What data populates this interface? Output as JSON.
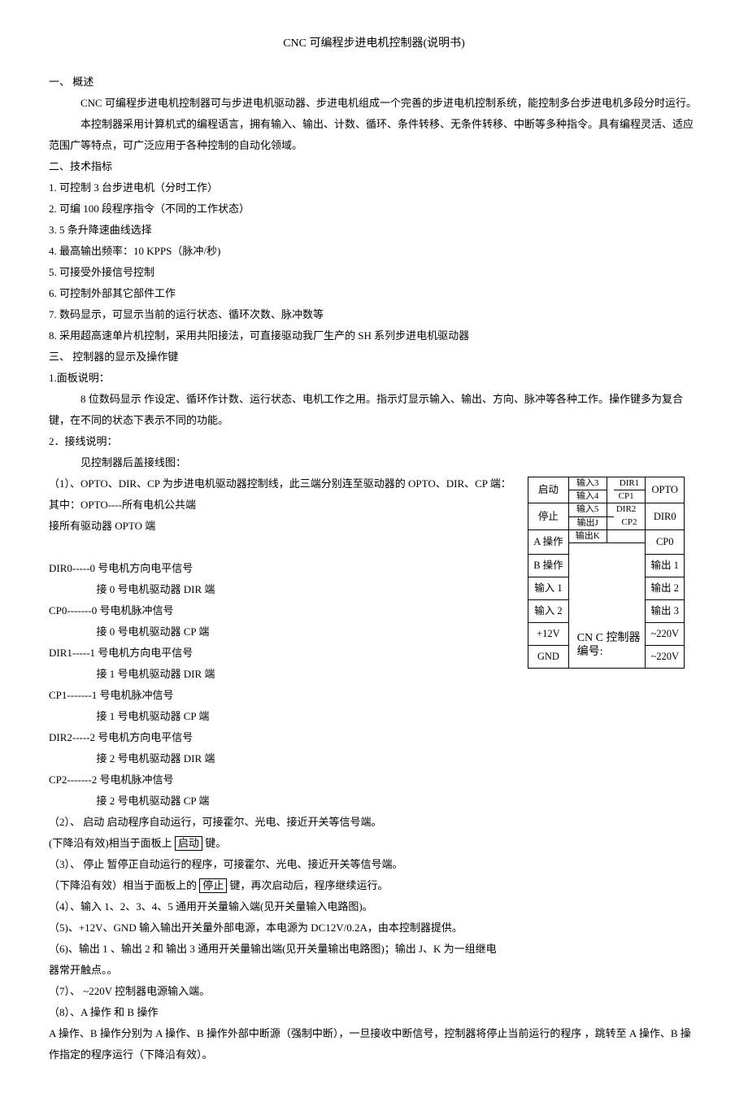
{
  "title": "CNC 可编程步进电机控制器(说明书)",
  "s1_h": "一、 概述",
  "s1_p1": "CNC 可编程步进电机控制器可与步进电机驱动器、步进电机组成一个完善的步进电机控制系统，能控制多台步进电机多段分时运行。",
  "s1_p2": "本控制器采用计算机式的编程语言，拥有输入、输出、计数、循环、条件转移、无条件转移、中断等多种指令。具有编程灵活、适应范围广等特点，可广泛应用于各种控制的自动化领域。",
  "s2_h": "二、技术指标",
  "s2_1": "1. 可控制 3 台步进电机（分时工作）",
  "s2_2": "2. 可编 100 段程序指令（不同的工作状态）",
  "s2_3": "3. 5 条升降速曲线选择",
  "s2_4": "4. 最高输出频率：10 KPPS（脉冲/秒)",
  "s2_5": "5. 可接受外接信号控制",
  "s2_6": "6. 可控制外部其它部件工作",
  "s2_7": "7. 数码显示，可显示当前的运行状态、循环次数、脉冲数等",
  "s2_8": "8. 采用超高速单片机控制，采用共阳接法，可直接驱动我厂生产的 SH 系列步进电机驱动器",
  "s3_h": "三、 控制器的显示及操作键",
  "s3_1h": "1.面板说明：",
  "s3_1p": "8 位数码显示 作设定、循环作计数、运行状态、电机工作之用。指示灯显示输入、输出、方向、脉冲等各种工作。操作键多为复合键，在不同的状态下表示不同的功能。",
  "s3_2h": "2．接线说明：",
  "s3_2p": "见控制器后盖接线图：",
  "n1": "（1）、OPTO、DIR、CP 为步进电机驱动器控制线，此三端分别连至驱动器的 OPTO、DIR、CP 端：",
  "n1a": "其中：OPTO----所有电机公共端",
  "n1b": "接所有驱动器 OPTO 端",
  "d0a": "DIR0-----0 号电机方向电平信号",
  "d0b": "接 0 号电机驱动器 DIR 端",
  "c0a": "CP0-------0 号电机脉冲信号",
  "c0b": "接 0 号电机驱动器 CP 端",
  "d1a": "DIR1-----1 号电机方向电平信号",
  "d1b": "接 1 号电机驱动器 DIR 端",
  "c1a": "CP1-------1 号电机脉冲信号",
  "c1b": "接 1 号电机驱动器 CP 端",
  "d2a": "DIR2-----2 号电机方向电平信号",
  "d2b": "接 2 号电机驱动器 DIR 端",
  "c2a": "CP2-------2 号电机脉冲信号",
  "c2b": "接 2 号电机驱动器 CP 端",
  "n2a": "（2）、 启动 启动程序自动运行，可接霍尔、光电、接近开关等信号端。",
  "n2b_pre": "(下降沿有效)相当于面板上 ",
  "n2b_box": "启动",
  "n2b_post": "  键。",
  "n3a": "（3）、 停止 暂停正自动运行的程序，可接霍尔、光电、接近开关等信号端。",
  "n3b_pre": "（下降沿有效）相当于面板上的 ",
  "n3b_box": "停止",
  "n3b_post": " 键，再次启动后，程序继续运行。",
  "n4": "（4）、输入 1、2、3、4、5 通用开关量输入端(见开关量输入电路图)。",
  "n5": "（5)、+12V、GND 输入输出开关量外部电源，本电源为 DC12V/0.2A，由本控制器提供。",
  "n6a": "（6)、输出 1 、输出 2 和 输出 3 通用开关量输出端(见开关量输出电路图)；输出 J、K 为一组继电",
  "n6b": "器常开触点。。",
  "n7": "（7）、 ~220V 控制器电源输入端。",
  "n8h": "（8）、A 操作 和 B 操作",
  "n8p": "A 操作、B 操作分别为 A 操作、B 操作外部中断源（强制中断），一旦接收中断信号，控制器将停止当前运行的程序  ，跳转至 A 操作、B 操作指定的程序运行（下降沿有效）。",
  "dg": {
    "l1": "启动",
    "l2": "停止",
    "l3": "A 操作",
    "l4": "B 操作",
    "l5": "输入 1",
    "l6": "输入 2",
    "l7": "+12V",
    "l8": "GND",
    "r1": "OPTO",
    "r2": "DIR0",
    "r3": "CP0",
    "r4": "输出 1",
    "r5": "输出 2",
    "r6": "输出 3",
    "r7": "~220V",
    "r8": "~220V",
    "m_in3": "输入3",
    "m_in4": "输入4",
    "m_in5": "输入5",
    "m_outJ": "输出J",
    "m_outK": "输出K",
    "m_dir1": "DIR1",
    "m_cp1": "CP1",
    "m_dir2": "DIR2",
    "m_cp2": "CP2",
    "cnc": "CN C 控制器",
    "serial": "编号:"
  }
}
